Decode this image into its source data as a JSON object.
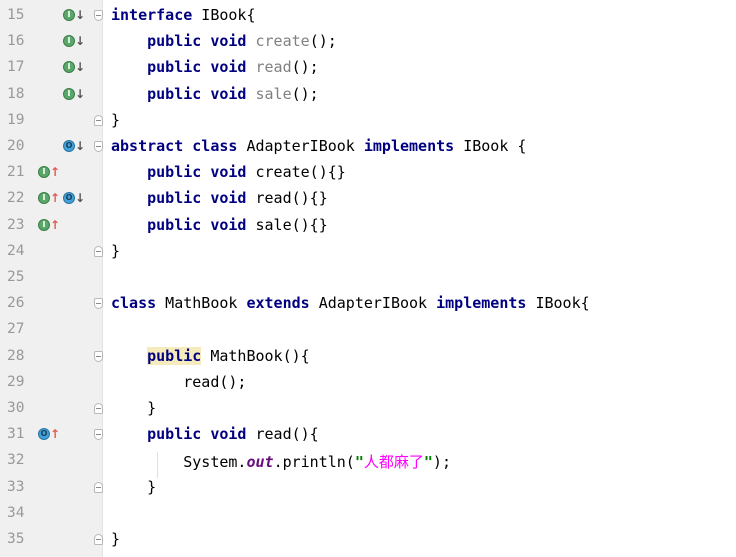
{
  "lines": [
    {
      "no": "15",
      "parts": [
        [
          "kw",
          "interface"
        ],
        [
          "",
          " IBook{"
        ]
      ]
    },
    {
      "no": "16",
      "parts": [
        [
          "",
          "    "
        ],
        [
          "kw",
          "public"
        ],
        [
          "",
          " "
        ],
        [
          "kw",
          "void"
        ],
        [
          "",
          " "
        ],
        [
          "fn-gray",
          "create"
        ],
        [
          "",
          "();"
        ]
      ]
    },
    {
      "no": "17",
      "parts": [
        [
          "",
          "    "
        ],
        [
          "kw",
          "public"
        ],
        [
          "",
          " "
        ],
        [
          "kw",
          "void"
        ],
        [
          "",
          " "
        ],
        [
          "fn-gray",
          "read"
        ],
        [
          "",
          "();"
        ]
      ]
    },
    {
      "no": "18",
      "parts": [
        [
          "",
          "    "
        ],
        [
          "kw",
          "public"
        ],
        [
          "",
          " "
        ],
        [
          "kw",
          "void"
        ],
        [
          "",
          " "
        ],
        [
          "fn-gray",
          "sale"
        ],
        [
          "",
          "();"
        ]
      ]
    },
    {
      "no": "19",
      "parts": [
        [
          "",
          "}"
        ]
      ]
    },
    {
      "no": "20",
      "parts": [
        [
          "kw",
          "abstract"
        ],
        [
          "",
          " "
        ],
        [
          "kw",
          "class"
        ],
        [
          "",
          " AdapterIBook "
        ],
        [
          "kw",
          "implements"
        ],
        [
          "",
          " IBook {"
        ]
      ]
    },
    {
      "no": "21",
      "parts": [
        [
          "",
          "    "
        ],
        [
          "kw",
          "public"
        ],
        [
          "",
          " "
        ],
        [
          "kw",
          "void"
        ],
        [
          "",
          " create(){}"
        ]
      ]
    },
    {
      "no": "22",
      "parts": [
        [
          "",
          "    "
        ],
        [
          "kw",
          "public"
        ],
        [
          "",
          " "
        ],
        [
          "kw",
          "void"
        ],
        [
          "",
          " read(){}"
        ]
      ]
    },
    {
      "no": "23",
      "parts": [
        [
          "",
          "    "
        ],
        [
          "kw",
          "public"
        ],
        [
          "",
          " "
        ],
        [
          "kw",
          "void"
        ],
        [
          "",
          " sale(){}"
        ]
      ]
    },
    {
      "no": "24",
      "parts": [
        [
          "",
          "}"
        ]
      ]
    },
    {
      "no": "25",
      "parts": []
    },
    {
      "no": "26",
      "parts": [
        [
          "kw",
          "class"
        ],
        [
          "",
          " MathBook "
        ],
        [
          "kw",
          "extends"
        ],
        [
          "",
          " AdapterIBook "
        ],
        [
          "kw",
          "implements"
        ],
        [
          "",
          " IBook{"
        ]
      ]
    },
    {
      "no": "27",
      "parts": []
    },
    {
      "no": "28",
      "parts": [
        [
          "",
          "    "
        ],
        [
          "kw hl",
          "public"
        ],
        [
          "",
          " MathBook(){"
        ]
      ]
    },
    {
      "no": "29",
      "parts": [
        [
          "",
          "        read();"
        ]
      ]
    },
    {
      "no": "30",
      "parts": [
        [
          "",
          "    }"
        ]
      ]
    },
    {
      "no": "31",
      "parts": [
        [
          "",
          "    "
        ],
        [
          "kw",
          "public"
        ],
        [
          "",
          " "
        ],
        [
          "kw",
          "void"
        ],
        [
          "",
          " read(){"
        ]
      ]
    },
    {
      "no": "32",
      "parts": [
        [
          "",
          "        System."
        ],
        [
          "field",
          "out"
        ],
        [
          "",
          ".println("
        ],
        [
          "str",
          "\""
        ],
        [
          "str-cjk",
          "人都麻了"
        ],
        [
          "str",
          "\""
        ],
        [
          "",
          ");"
        ]
      ]
    },
    {
      "no": "33",
      "parts": [
        [
          "",
          "    }"
        ]
      ]
    },
    {
      "no": "34",
      "parts": []
    },
    {
      "no": "35",
      "parts": [
        [
          "",
          "}"
        ]
      ]
    }
  ],
  "gutter_markers": {
    "15": [
      [
        "impl",
        "I",
        "down"
      ]
    ],
    "16": [
      [
        "impl",
        "I",
        "down"
      ]
    ],
    "17": [
      [
        "impl",
        "I",
        "down"
      ]
    ],
    "18": [
      [
        "impl",
        "I",
        "down"
      ]
    ],
    "20": [
      [
        "over",
        "O",
        "down"
      ]
    ],
    "21": [
      [
        "impl",
        "I",
        "up"
      ]
    ],
    "22": [
      [
        "impl",
        "I",
        "up"
      ],
      [
        "over",
        "O",
        "down"
      ]
    ],
    "23": [
      [
        "impl",
        "I",
        "up"
      ]
    ],
    "31": [
      [
        "over",
        "O",
        "up"
      ]
    ]
  },
  "folds": {
    "15": "open",
    "19": "close",
    "20": "open",
    "24": "close",
    "26": "open",
    "28": "open",
    "30": "close",
    "31": "open",
    "33": "close",
    "35": "close"
  },
  "colors": {
    "keyword": "#000080",
    "string": "#008000",
    "string_cjk": "#ff00ff",
    "field": "#660e7a",
    "method_gray": "#808080",
    "gutter_bg": "#f0f0f0",
    "caret_highlight": "#f6ebbc"
  }
}
